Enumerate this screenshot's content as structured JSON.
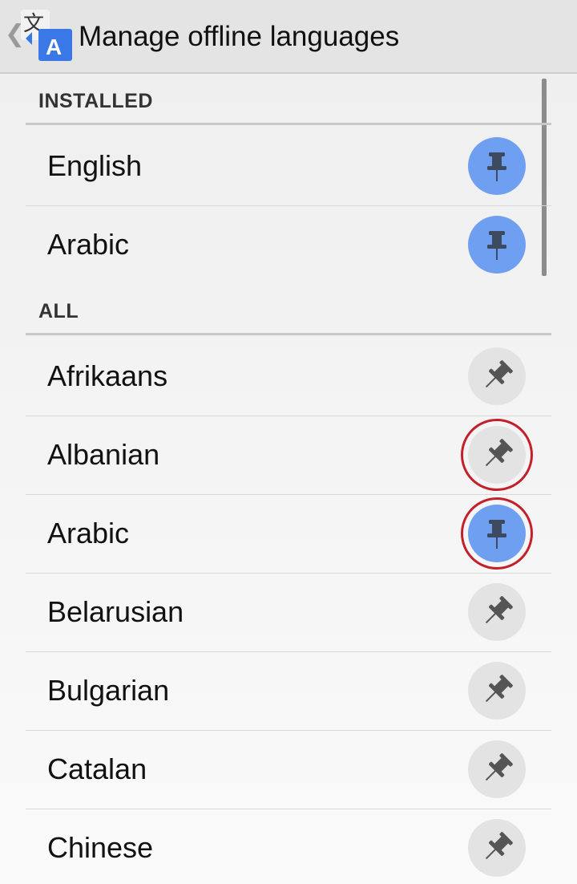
{
  "action_bar": {
    "title": "Manage offline languages",
    "back_icon": "chevron-left-icon",
    "app_icon": "translate-icon",
    "app_icon_glyph_a": "A",
    "app_icon_glyph_wen": "文"
  },
  "sections": [
    {
      "header": "INSTALLED",
      "items": [
        {
          "label": "English",
          "state": "pinned"
        },
        {
          "label": "Arabic",
          "state": "pinned"
        }
      ]
    },
    {
      "header": "ALL",
      "items": [
        {
          "label": "Afrikaans",
          "state": "unpinned"
        },
        {
          "label": "Albanian",
          "state": "unpinned",
          "highlighted": true
        },
        {
          "label": "Arabic",
          "state": "pinned",
          "highlighted": true
        },
        {
          "label": "Belarusian",
          "state": "unpinned"
        },
        {
          "label": "Bulgarian",
          "state": "unpinned"
        },
        {
          "label": "Catalan",
          "state": "unpinned"
        },
        {
          "label": "Chinese",
          "state": "unpinned"
        }
      ]
    }
  ],
  "colors": {
    "pinned_bg": "#6f9ff0",
    "unpinned_bg": "#e3e3e3",
    "highlight_ring": "#c4202a",
    "action_bar_bg": "#e4e4e4"
  }
}
